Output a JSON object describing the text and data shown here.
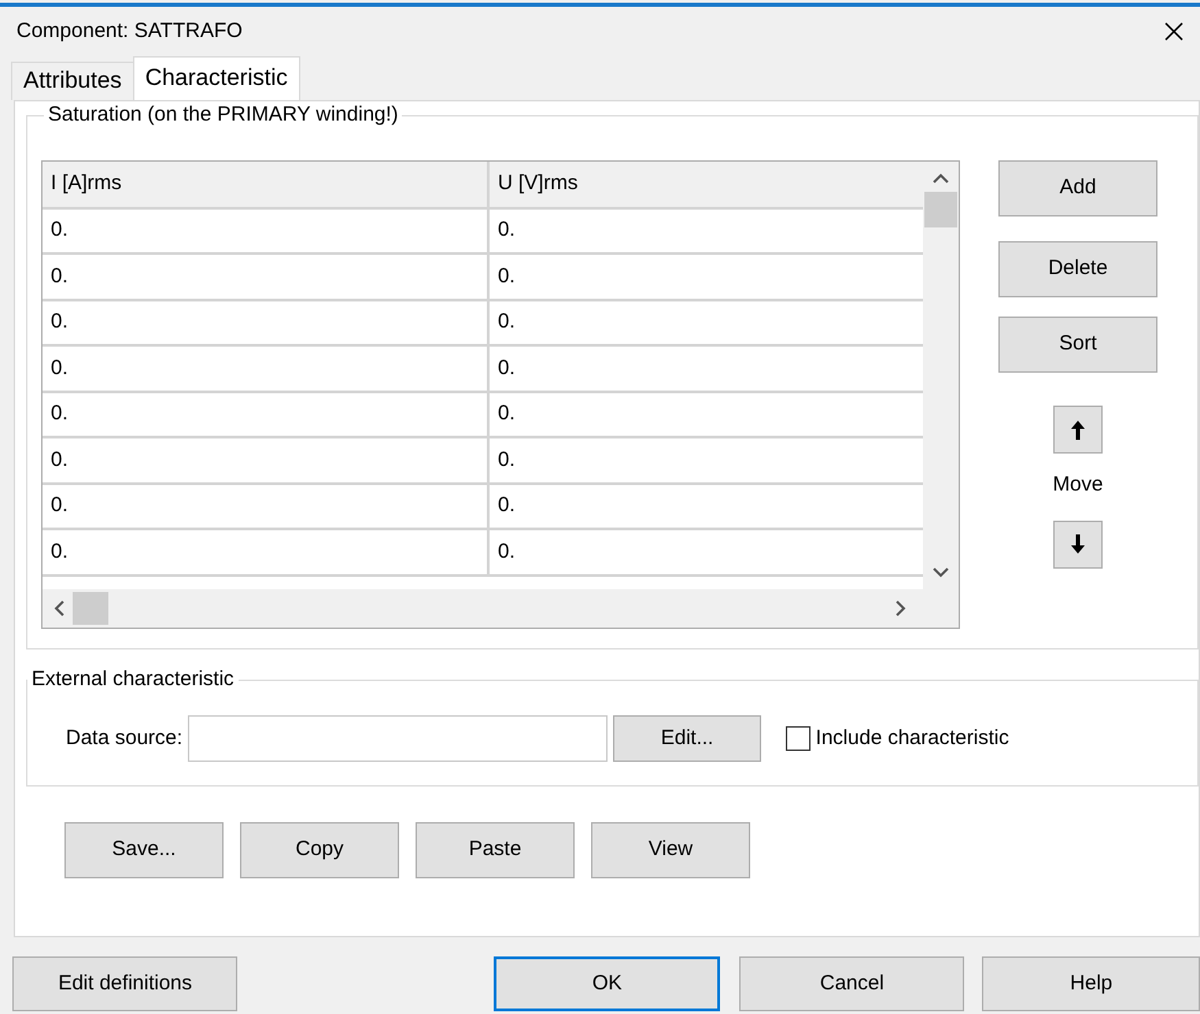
{
  "window": {
    "title": "Component: SATTRAFO"
  },
  "tabs": [
    {
      "label": "Attributes",
      "selected": false
    },
    {
      "label": "Characteristic",
      "selected": true
    }
  ],
  "saturation": {
    "title": "Saturation (on the PRIMARY winding!)",
    "table": {
      "columns": [
        "I [A]rms",
        "U [V]rms"
      ],
      "rows": [
        [
          "0.",
          "0."
        ],
        [
          "0.",
          "0."
        ],
        [
          "0.",
          "0."
        ],
        [
          "0.",
          "0."
        ],
        [
          "0.",
          "0."
        ],
        [
          "0.",
          "0."
        ],
        [
          "0.",
          "0."
        ],
        [
          "0.",
          "0."
        ]
      ]
    },
    "buttons": [
      "Add",
      "Delete",
      "Sort"
    ],
    "move_label": "Move"
  },
  "external": {
    "title": "External characteristic",
    "data_source_label": "Data source:",
    "edit_button": "Edit...",
    "include": {
      "label": "Include characteristic",
      "checked": false
    }
  },
  "actions": [
    "Save...",
    "Copy",
    "Paste",
    "View"
  ],
  "footer": [
    {
      "label": "Edit definitions",
      "default": false
    },
    {
      "label": "OK",
      "default": true
    },
    {
      "label": "Cancel",
      "default": false
    },
    {
      "label": "Help",
      "default": false
    }
  ]
}
